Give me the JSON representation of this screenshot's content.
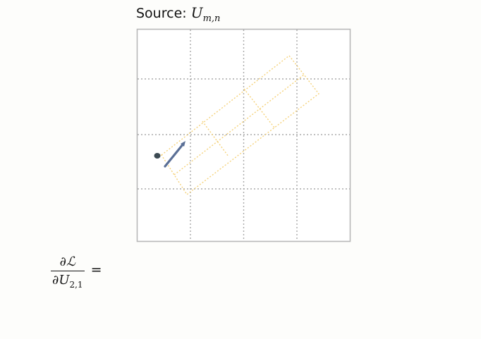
{
  "title": {
    "prefix": "Source: ",
    "variable": "U",
    "subscript": "m,n"
  },
  "grid": {
    "rows": 4,
    "cols": 4,
    "border_color": "#b8b8b8",
    "line_color": "#a8a8a8"
  },
  "overlay": {
    "color": "#f5d27a"
  },
  "arrow": {
    "color": "#5a6f96"
  },
  "point": {
    "color": "#3c4a52"
  },
  "formula": {
    "numerator": "∂ℒ",
    "denominator_prefix": "∂",
    "denominator_var": "U",
    "denominator_sub": "2,1",
    "equals": "="
  }
}
